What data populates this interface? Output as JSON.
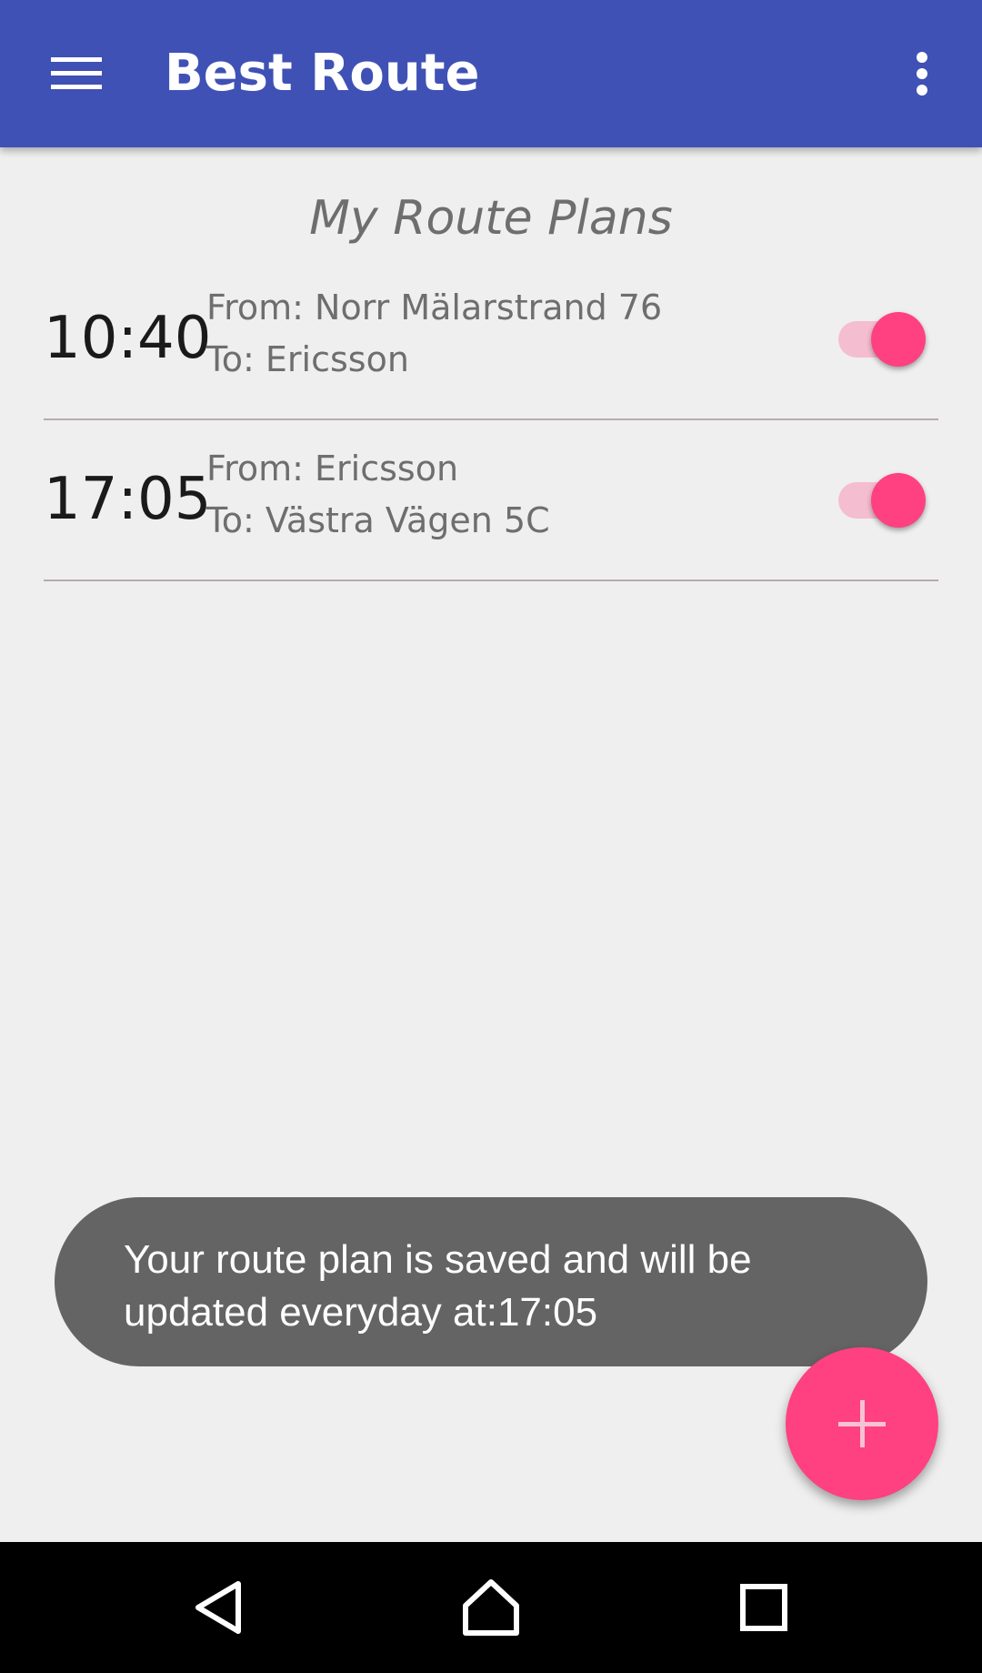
{
  "app_bar": {
    "title": "Best Route",
    "menu_icon": "menu-icon",
    "overflow_icon": "more-vert-icon",
    "color": "#3f51b5"
  },
  "main": {
    "heading": "My Route Plans",
    "routes": [
      {
        "time": "10:40",
        "from": "From: Norr Mälarstrand 76",
        "to": "To: Ericsson",
        "enabled": true
      },
      {
        "time": "17:05",
        "from": "From: Ericsson",
        "to": "To: Västra Vägen 5C",
        "enabled": true
      }
    ]
  },
  "toast": {
    "message": "Your route plan is saved and will be updated everyday at:17:05"
  },
  "fab": {
    "icon": "plus-icon",
    "color": "#ff4081"
  },
  "nav_bar": {
    "back_icon": "back-icon",
    "home_icon": "home-icon",
    "recents_icon": "recents-icon"
  },
  "colors": {
    "accent": "#ff4081",
    "primary": "#3f51b5",
    "background": "#efefef"
  }
}
